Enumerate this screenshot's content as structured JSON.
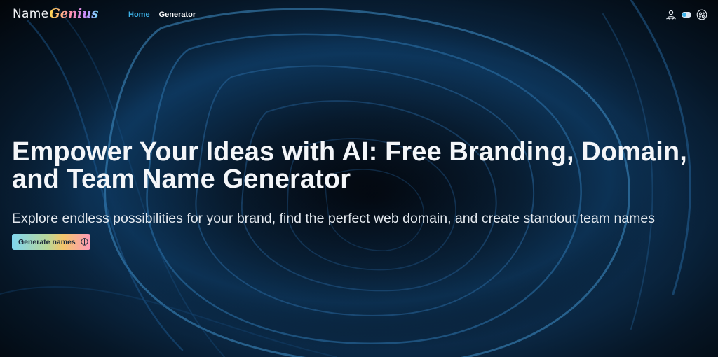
{
  "nav": {
    "logo": {
      "name": "Name",
      "genius": "Genius"
    },
    "links": [
      {
        "label": "Home",
        "active": true
      },
      {
        "label": "Generator",
        "active": false
      }
    ],
    "icons": [
      "team-icon",
      "theme-toggle",
      "settings-icon"
    ]
  },
  "hero": {
    "title": "Empower Your Ideas with AI: Free Branding, Domain, and Team Name Generator",
    "subtitle": "Explore endless possibilities for your brand, find the perfect web domain, and create standout team names",
    "cta_label": "Generate names",
    "cta_icon": "brain-icon"
  },
  "colors": {
    "accent": "#3db3ea",
    "background": "#04070d",
    "text": "#f4f6f9"
  }
}
